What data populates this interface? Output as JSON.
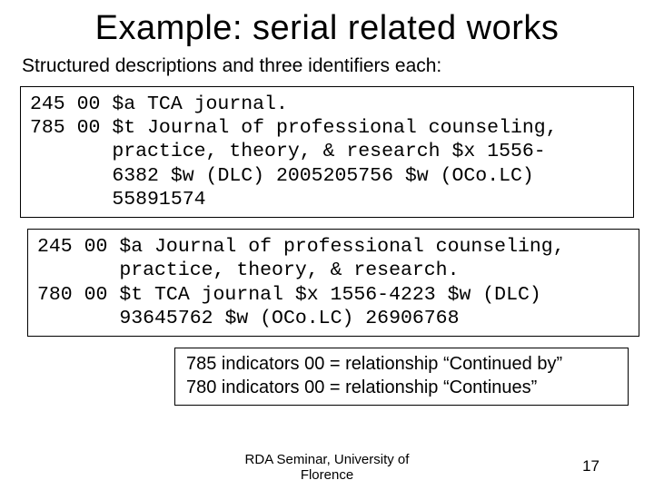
{
  "title": "Example:  serial related works",
  "subtitle": "Structured descriptions and three identifiers each:",
  "record1": "245 00 $a TCA journal.\n785 00 $t Journal of professional counseling,\n       practice, theory, & research $x 1556-\n       6382 $w (DLC) 2005205756 $w (OCo.LC)\n       55891574",
  "record2": "245 00 $a Journal of professional counseling,\n       practice, theory, & research.\n780 00 $t TCA journal $x 1556-4223 $w (DLC)\n       93645762 $w (OCo.LC) 26906768",
  "note_line1": "785 indicators 00 = relationship “Continued by”",
  "note_line2": "780 indicators 00 = relationship “Continues”",
  "footer": "RDA Seminar, University of Florence",
  "page": "17"
}
